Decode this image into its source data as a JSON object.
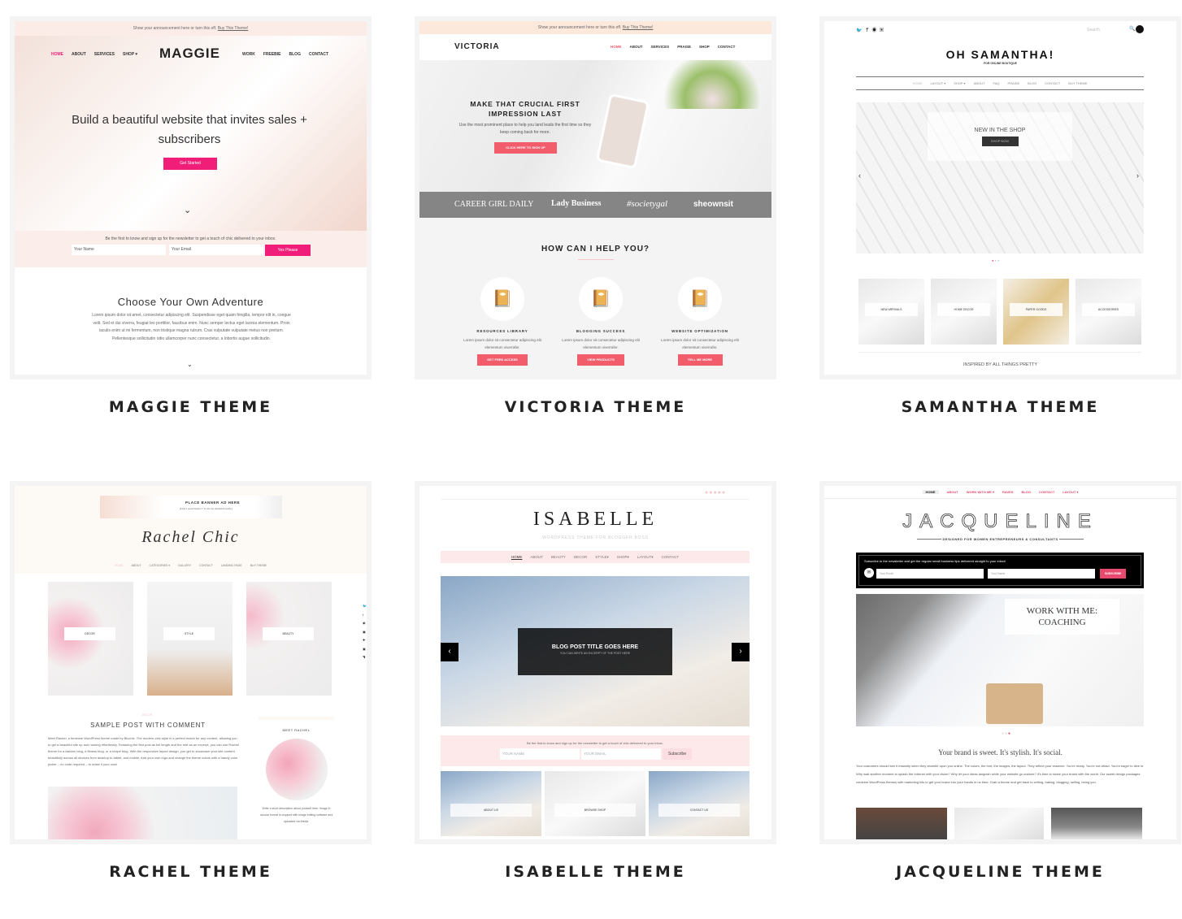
{
  "themes": [
    {
      "caption": "MAGGIE THEME",
      "announcement": "Show your announcement here or turn this off.",
      "announcement_link": "Buy This Theme!",
      "logo": "MAGGIE",
      "nav_left": [
        "HOME",
        "ABOUT",
        "SERVICES",
        "SHOP ▾"
      ],
      "nav_right": [
        "WORK",
        "FREEBIE",
        "BLOG",
        "CONTACT"
      ],
      "hero_title": "Build a beautiful website that invites sales + subscribers",
      "hero_button": "Get Started",
      "newsletter_text": "Be the first to know and sign up for the newsletter to get a touch of chic delivered to your inbox.",
      "name_placeholder": "Your Name",
      "email_placeholder": "Your Email",
      "newsletter_button": "Yes Please",
      "section_title": "Choose Your Own Adventure",
      "section_body": "Lorem ipsum dolor sit amet, consectetur adipiscing elit. Suspendisse eget quam fringilla, tempor elit in, congue velit. Sed et dui viverra, feugiat leo porttitor, faucibus enim. Nunc semper lectus eget lacinia elementum. Proin iaculis enim ut mi fermentum, non tristique magna rutrum. Cras vulputate vulputate metus non pretium. Pellentesque sollicitudin odio ullamcorper nunc consectetur, a lobortis augue sollicitudin."
    },
    {
      "caption": "VICTORIA THEME",
      "announcement": "Show your announcement here or turn this off.",
      "announcement_link": "Buy This Theme!",
      "logo": "VICTORIA",
      "nav": [
        "HOME",
        "ABOUT",
        "SERVICES",
        "PRAISE",
        "SHOP",
        "CONTACT"
      ],
      "hero_title": "MAKE THAT CRUCIAL FIRST IMPRESSION LAST",
      "hero_body": "Use the most prominent place to help you land leads the first time so they keep coming back for more.",
      "hero_button": "CLICK HERE TO SIGN UP",
      "press": [
        "CAREER GIRL DAILY",
        "Lady Business",
        "#societygal",
        "sheownsit"
      ],
      "help_title": "HOW CAN I HELP YOU?",
      "features": [
        {
          "title": "RESOURCES LIBRARY",
          "body": "Lorem ipsum dolor sit consectetur adipiscing elit elementum viverrafer.",
          "button": "GET FREE ACCESS"
        },
        {
          "title": "BLOGGING SUCCESS",
          "body": "Lorem ipsum dolor sit consectetur adipiscing elit elementum viverrafer.",
          "button": "VIEW PRODUCTS"
        },
        {
          "title": "WEBSITE OPTIMIZATION",
          "body": "Lorem ipsum dolor sit consectetur adipiscing elit elementum viverrafer.",
          "button": "TELL ME MORE"
        }
      ]
    },
    {
      "caption": "SAMANTHA THEME",
      "search_placeholder": "Search",
      "logo": "OH SAMANTHA!",
      "tagline": "FOR ONLINE BOUTIQUE",
      "nav": [
        "HOME",
        "LAYOUT ▾",
        "SHOP ▾",
        "ABOUT",
        "FAQ",
        "PRAISE",
        "BLOG",
        "CONTACT",
        "BUY THEME"
      ],
      "slide_title": "NEW IN THE SHOP",
      "slide_button": "SHOP NOW",
      "categories": [
        "NEW ARRIVALS",
        "HOME DECOR",
        "PAPER GOODS",
        "ACCESSORIES"
      ],
      "footer_text": "INSPIRED BY ALL THINGS PRETTY"
    },
    {
      "caption": "RACHEL THEME",
      "banner_title": "PLACE BANNER AD HERE",
      "banner_sub": "(Don't need banner? It can be disabled easily)",
      "logo": "Rachel Chic",
      "nav": [
        "HOME",
        "ABOUT",
        "CATEGORIES ▾",
        "GALLERY",
        "CONTACT",
        "LANDING PAGE",
        "BUY THEME"
      ],
      "tiles": [
        "DECOR",
        "STYLE",
        "BEAUTY"
      ],
      "post_category": "DECOR",
      "post_title": "SAMPLE POST WITH COMMENT",
      "post_body": "Meet Rachel, a feminine WordPress theme made by Bluchic. The modern-chic style is a perfect match for any content, allowing you to get a beautiful site up and running effortlessly. Featuring the first post as full length and the rest as an excerpt, you can use Rachel theme for a fashion blog, a fitness blog, or a recipe blog. With the responsive layout design, you get to showcase your site content beautifully across all devices from desktop to tablet, and mobile. Add your own logo and change the theme colors with a handy color picker – no code required – to make it your own!",
      "sidebar_title": "MEET RACHEL",
      "sidebar_body": "Write a short description about yourself here. Image in circular format is cropped with image editing software and uploaded via Media."
    },
    {
      "caption": "ISABELLE THEME",
      "logo": "ISABELLE",
      "tagline": "WORDPRESS THEME FOR BLOGGER BOSS",
      "nav": [
        "HOME",
        "ABOUT",
        "BEAUTY",
        "DECOR",
        "STYLE▾",
        "SHOP▾",
        "LAYOUT▾",
        "CONTACT"
      ],
      "slide_title": "BLOG POST TITLE GOES HERE",
      "slide_sub": "YOU CAN WRITE AN EXCERPT OF THE POST HERE",
      "newsletter_text": "Be the first to know and sign up for the newsletter to get a touch of chic delivered to your inbox.",
      "name_placeholder": "YOUR NAME",
      "email_placeholder": "YOUR EMAIL",
      "newsletter_button": "Subscribe",
      "tiles": [
        "ABOUT US",
        "BROWSE SHOP",
        "CONTACT US"
      ]
    },
    {
      "caption": "JACQUELINE THEME",
      "nav": [
        "HOME",
        "ABOUT",
        "WORK WITH ME ▾",
        "RAVES",
        "BLOG",
        "CONTACT",
        "LAYOUT ▾"
      ],
      "logo": "JACQUELINE",
      "tagline": "DESIGNED FOR WOMEN ENTREPRENEURS & CONSULTANTS",
      "optin_text": "Subscribe to the newsletter and get the regular small business tips delivered straight to your inbox!",
      "email_placeholder": "Your Email",
      "name_placeholder": "Your Name",
      "optin_button": "SUBSCRIBE",
      "slide_title": "WORK WITH ME: COACHING",
      "intro_title": "Your brand is sweet. It's stylish. It's social.",
      "intro_body": "Your customers should see it instantly when they stumble upon you online. The colors, the font, the images, the layout. They reflect your essence. You're ready. You're not afraid. You're eager to dive in. Why wait another moment to splash the Internet with your vision? Why let your ideas languish while your website go undone? It's time to share your brand with the world. Our sweet design packages combine WordPress themes with marketing kits to get your brand into your hands in no time. Grab a theme and get back to writing, baking, blogging, selling, being you."
    }
  ],
  "colors": {
    "pink": "#f01e78",
    "coral": "#f25d6c",
    "jacq_pink": "#e84a6f"
  }
}
